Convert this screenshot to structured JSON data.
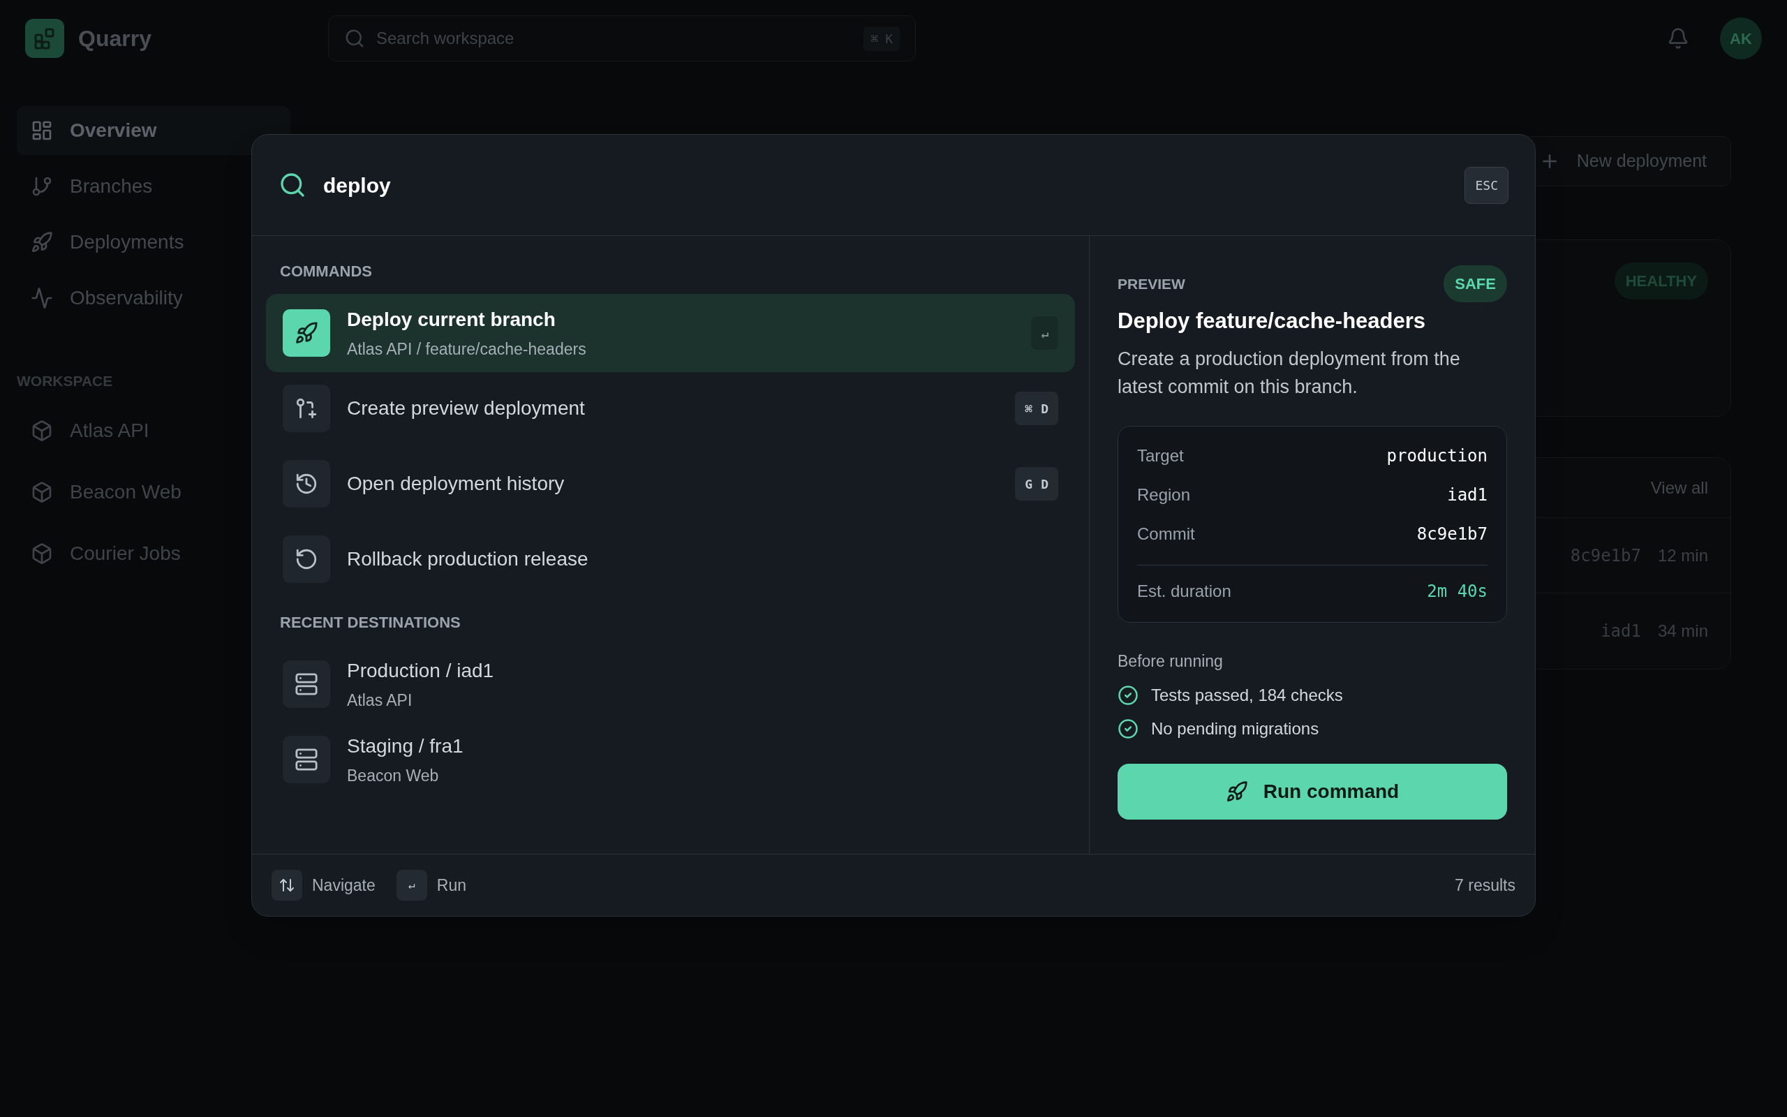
{
  "app": {
    "name": "Quarry"
  },
  "search": {
    "placeholder": "Search workspace",
    "shortcut": [
      "⌘",
      "K"
    ]
  },
  "user": {
    "initials": "AK"
  },
  "sidebar": {
    "items": [
      {
        "label": "Overview",
        "selected": true
      },
      {
        "label": "Branches",
        "selected": false
      },
      {
        "label": "Deployments",
        "selected": false
      },
      {
        "label": "Observability",
        "selected": false
      }
    ],
    "workspace_title": "WORKSPACE",
    "projects": [
      {
        "label": "Atlas API"
      },
      {
        "label": "Beacon Web"
      },
      {
        "label": "Courier Jobs"
      }
    ]
  },
  "page": {
    "new_button": "New deployment",
    "status_badge": "HEALTHY",
    "recent": {
      "link": "View all",
      "rows": [
        {
          "column_1": "8c9e1b7",
          "column_2": "12 min"
        },
        {
          "column_1": "iad1",
          "column_2": "34 min"
        }
      ]
    }
  },
  "palette": {
    "query": "deploy",
    "esc": "ESC",
    "sections": [
      {
        "title": "COMMANDS",
        "items": [
          {
            "title": "Deploy current branch",
            "subtitle": "Atlas API / feature/cache-headers",
            "keys": [
              "↵"
            ],
            "selected": true
          },
          {
            "title": "Create preview deployment",
            "keys": [
              "⌘",
              "D"
            ],
            "selected": false
          },
          {
            "title": "Open deployment history",
            "keys": [
              "G",
              "D"
            ],
            "selected": false
          },
          {
            "title": "Rollback production release",
            "selected": false
          }
        ]
      },
      {
        "title": "RECENT DESTINATIONS",
        "items": [
          {
            "title": "Production / iad1",
            "subtitle": "Atlas API",
            "selected": false
          },
          {
            "title": "Staging / fra1",
            "subtitle": "Beacon Web",
            "selected": false
          }
        ]
      }
    ],
    "preview": {
      "label": "PREVIEW",
      "badge": "SAFE",
      "title": "Deploy feature/cache-headers",
      "description": "Create a production deployment from the latest commit on this branch.",
      "details": [
        {
          "label": "Target",
          "value": "production"
        },
        {
          "label": "Region",
          "value": "iad1"
        },
        {
          "label": "Commit",
          "value": "8c9e1b7"
        }
      ],
      "estimate": {
        "label": "Est. duration",
        "value": "2m 40s"
      },
      "checks_title": "Before running",
      "checks": [
        {
          "label": "Tests passed, 184 checks",
          "passed": true
        },
        {
          "label": "No pending migrations",
          "passed": true
        }
      ],
      "run_button": "Run command"
    },
    "footer": {
      "hints": [
        {
          "kind": "icon",
          "label": "Navigate"
        },
        {
          "kind": "key",
          "key": "↵",
          "label": "Run"
        }
      ],
      "results": "7 results"
    }
  }
}
